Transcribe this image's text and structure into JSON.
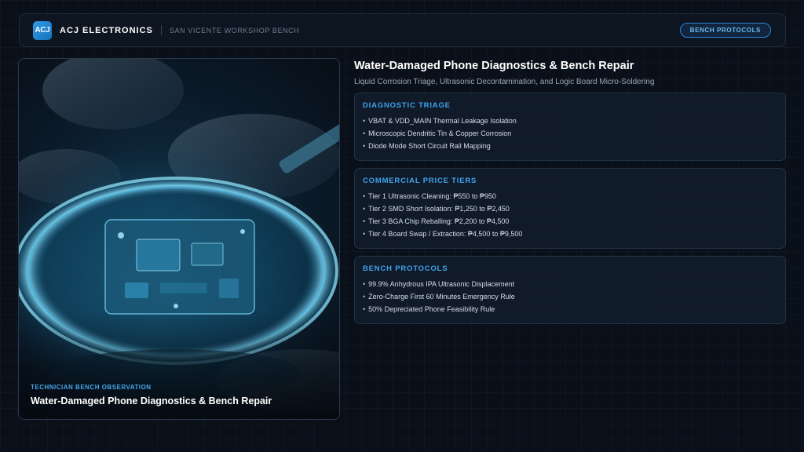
{
  "header": {
    "logo_text": "ACJ",
    "brand": "ACJ ELECTRONICS",
    "bench": "SAN VICENTE WORKSHOP BENCH",
    "button_label": "BENCH PROTOCOLS"
  },
  "photo": {
    "kicker": "TECHNICIAN BENCH OBSERVATION",
    "title": "Water-Damaged Phone Diagnostics & Bench Repair"
  },
  "main": {
    "title": "Water-Damaged Phone Diagnostics & Bench Repair",
    "subtitle": "Liquid Corrosion Triage, Ultrasonic Decontamination, and Logic Board Micro-Soldering"
  },
  "panels": [
    {
      "heading": "DIAGNOSTIC TRIAGE",
      "items": [
        "VBAT & VDD_MAIN Thermal Leakage Isolation",
        "Microscopic Dendritic Tin & Copper Corrosion",
        "Diode Mode Short Circuit Rail Mapping"
      ]
    },
    {
      "heading": "COMMERCIAL PRICE TIERS",
      "items": [
        "Tier 1 Ultrasonic Cleaning: ₱550 to ₱950",
        "Tier 2 SMD Short Isolation: ₱1,250 to ₱2,450",
        "Tier 3 BGA Chip Reballing: ₱2,200 to ₱4,500",
        "Tier 4 Board Swap / Extraction: ₱4,500 to ₱9,500"
      ]
    },
    {
      "heading": "BENCH PROTOCOLS",
      "items": [
        "99.9% Anhydrous IPA Ultrasonic Displacement",
        "Zero-Charge First 60 Minutes Emergency Rule",
        "50% Depreciated Phone Feasibility Rule"
      ]
    }
  ]
}
